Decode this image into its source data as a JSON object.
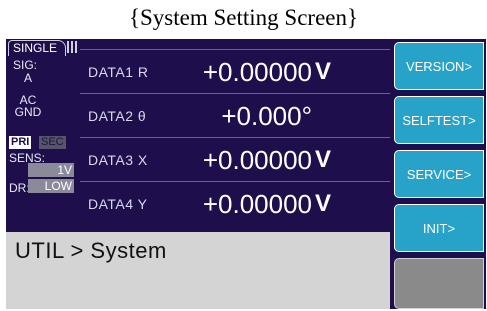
{
  "caption": "{System Setting Screen}",
  "status": {
    "mode": "SINGLE",
    "sig_label": "SIG:",
    "sig_value": "A",
    "coupling_1": "AC",
    "coupling_2": "GND",
    "pri": "PRI",
    "sec": "SEC",
    "sens_label": "SENS:",
    "sens_value": "1V",
    "dr_label": "DR:",
    "dr_value": "LOW"
  },
  "rows": [
    {
      "label": "DATA1  R",
      "value": "+0.00000",
      "unit": "V"
    },
    {
      "label": "DATA2  θ",
      "value": "+0.000°",
      "unit": ""
    },
    {
      "label": "DATA3  X",
      "value": "+0.00000",
      "unit": "V"
    },
    {
      "label": "DATA4  Y",
      "value": "+0.00000",
      "unit": "V"
    }
  ],
  "breadcrumb": "UTIL > System",
  "softkeys": [
    "VERSION>",
    "SELFTEST>",
    "SERVICE>",
    "INIT>"
  ]
}
